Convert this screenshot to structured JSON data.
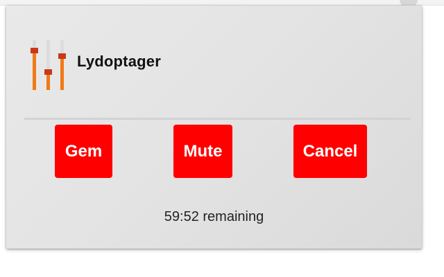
{
  "popup": {
    "title": "Lydoptager",
    "icon": "equalizer-sliders-icon",
    "buttons": {
      "gem_label": "Gem",
      "mute_label": "Mute",
      "cancel_label": "Cancel"
    },
    "status_text": "59:52 remaining"
  },
  "colors": {
    "button_bg": "#ff0000",
    "button_text": "#ffffff",
    "slider_orange": "#f07a16",
    "slider_knob": "#c9381a",
    "slider_track": "#dcdcdc"
  }
}
